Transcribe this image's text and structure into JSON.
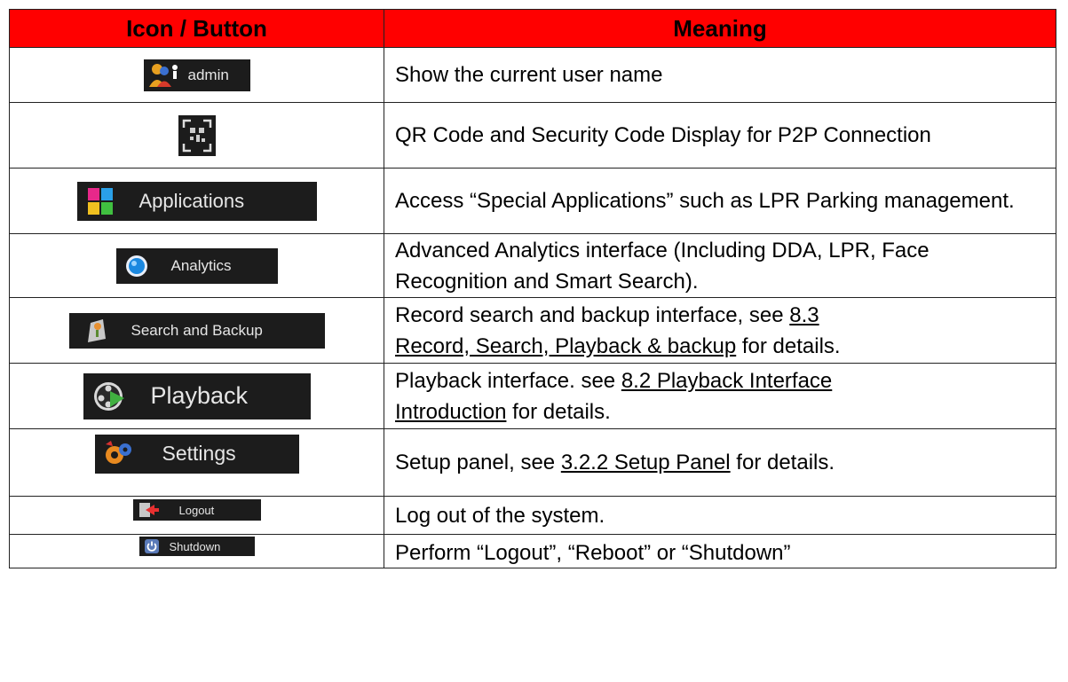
{
  "table": {
    "headers": {
      "icon": "Icon / Button",
      "meaning": "Meaning"
    },
    "rows": [
      {
        "icon_label": "admin",
        "icon": "user-icon",
        "meaning": "Show the current user name"
      },
      {
        "icon_label": "",
        "icon": "qr-code-icon",
        "meaning": "QR Code and Security Code Display for P2P Connection"
      },
      {
        "icon_label": "Applications",
        "icon": "applications-icon",
        "meaning": "Access “Special Applications” such as LPR Parking management."
      },
      {
        "icon_label": "Analytics",
        "icon": "analytics-icon",
        "meaning": "Advanced Analytics interface (Including DDA, LPR, Face Recognition and Smart Search)."
      },
      {
        "icon_label": "Search and Backup",
        "icon": "search-backup-icon",
        "meaning_pre": "Record search and backup interface, see ",
        "link_a": "8.3",
        "link_b": "Record, Search, Playback & backup",
        "meaning_post": " for details."
      },
      {
        "icon_label": "Playback",
        "icon": "playback-icon",
        "meaning_pre": "Playback interface. see ",
        "link_a": "8.2 Playback Interface",
        "link_b": "Introduction",
        "meaning_post": " for details."
      },
      {
        "icon_label": "Settings",
        "icon": "settings-icon",
        "meaning_pre": "Setup panel, see ",
        "link": "3.2.2 Setup Panel",
        "meaning_post": " for details."
      },
      {
        "icon_label": "Logout",
        "icon": "logout-icon",
        "meaning": "Log out of the system."
      },
      {
        "icon_label": "Shutdown",
        "icon": "shutdown-icon",
        "meaning": "Perform “Logout”, “Reboot” or “Shutdown”"
      }
    ]
  }
}
